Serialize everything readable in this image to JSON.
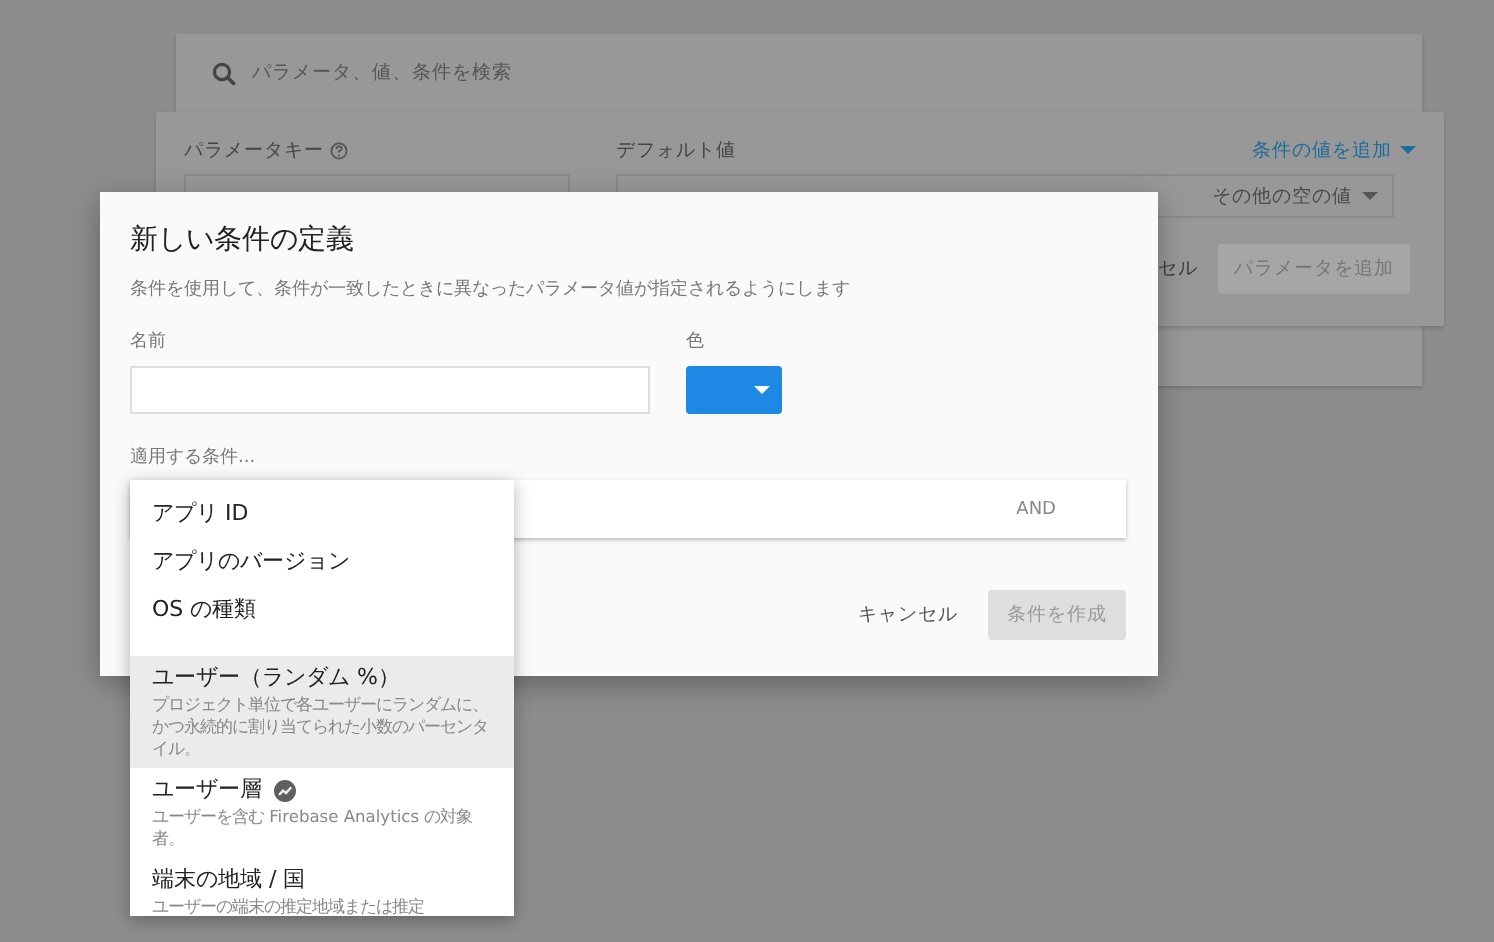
{
  "background": {
    "search": {
      "placeholder": "パラメータ、値、条件を検索"
    },
    "parameter_form": {
      "key_label": "パラメータキー",
      "default_label": "デフォルト値",
      "add_condition_link": "条件の値を追加",
      "value_menu": "その他の空の値",
      "cancel_button": "セル",
      "add_button": "パラメータを追加"
    }
  },
  "dialog": {
    "title": "新しい条件の定義",
    "description": "条件を使用して、条件が一致したときに異なったパラメータ値が指定されるようにします",
    "name_label": "名前",
    "color_label": "色",
    "conditions_label": "適用する条件...",
    "condition_row": {
      "operator": "AND"
    },
    "buttons": [
      {
        "label": "キャンセル",
        "kind": "flat",
        "disabled": false
      },
      {
        "label": "条件を作成",
        "kind": "raised",
        "disabled": true
      }
    ]
  },
  "menu": {
    "items": [
      {
        "title": "アプリ ID",
        "kind": "plain",
        "selected": false
      },
      {
        "title": "アプリのバージョン",
        "kind": "plain",
        "selected": false
      },
      {
        "title": "OS の種類",
        "kind": "plain",
        "selected": false
      },
      {
        "title": "ユーザー（ランダム %）",
        "description": "プロジェクト単位で各ユーザーにランダムに、かつ永続的に割り当てられた小数のパーセンタイル。",
        "kind": "detail",
        "selected": true
      },
      {
        "title": "ユーザー層",
        "description": "ユーザーを含む Firebase Analytics の対象者。",
        "kind": "analytics",
        "selected": false
      },
      {
        "title": "端末の地域 / 国",
        "description": "ユーザーの端末の推定地域または推定",
        "kind": "detail",
        "selected": false
      }
    ]
  }
}
